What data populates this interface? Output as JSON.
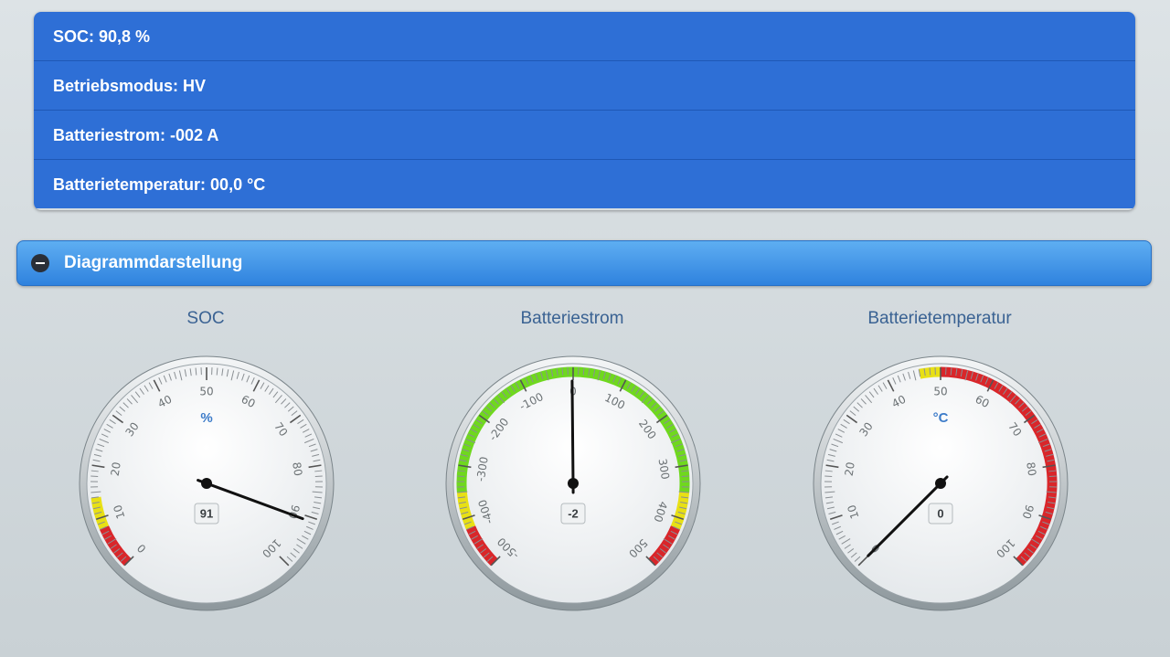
{
  "status": {
    "soc": "SOC: 90,8 %",
    "mode": "Betriebsmodus: HV",
    "current": "Batteriestrom: -002 A",
    "temperature": "Batterietemperatur: 00,0 °C"
  },
  "section": {
    "label": "Diagrammdarstellung",
    "icon": "minus-circle-icon"
  },
  "gauges": [
    {
      "title": "SOC",
      "unit": "%",
      "value": 90.8,
      "display": "91",
      "min": 0,
      "max": 100,
      "labels": [
        "0",
        "10",
        "20",
        "30",
        "40",
        "50",
        "60",
        "70",
        "80",
        "90",
        "100"
      ],
      "bands": [
        {
          "from": 0,
          "to": 8,
          "color": "#d9262a"
        },
        {
          "from": 8,
          "to": 14,
          "color": "#e8e014"
        }
      ]
    },
    {
      "title": "Batteriestrom",
      "unit": "",
      "value": -2,
      "display": "-2",
      "min": -500,
      "max": 500,
      "labels": [
        "-500",
        "-400",
        "-300",
        "-200",
        "-100",
        "0",
        "100",
        "200",
        "300",
        "400",
        "500"
      ],
      "bands": [
        {
          "from": -500,
          "to": -420,
          "color": "#d9262a"
        },
        {
          "from": -420,
          "to": -350,
          "color": "#e8e014"
        },
        {
          "from": -350,
          "to": 350,
          "color": "#6fd81e"
        },
        {
          "from": 350,
          "to": 420,
          "color": "#e8e014"
        },
        {
          "from": 420,
          "to": 500,
          "color": "#d9262a"
        }
      ]
    },
    {
      "title": "Batterietemperatur",
      "unit": "°C",
      "value": 0,
      "display": "0",
      "min": 0,
      "max": 100,
      "labels": [
        "0",
        "10",
        "20",
        "30",
        "40",
        "50",
        "60",
        "70",
        "80",
        "90",
        "100"
      ],
      "bands": [
        {
          "from": 46,
          "to": 50,
          "color": "#e8e014"
        },
        {
          "from": 50,
          "to": 100,
          "color": "#d9262a"
        }
      ]
    }
  ],
  "colors": {
    "row_bg": "#2e6fd6",
    "header_gradient_top": "#5eaef2",
    "header_gradient_bottom": "#2f82de",
    "gauge_title": "#3a6293",
    "red": "#d9262a",
    "yellow": "#e8e014",
    "green": "#6fd81e"
  }
}
